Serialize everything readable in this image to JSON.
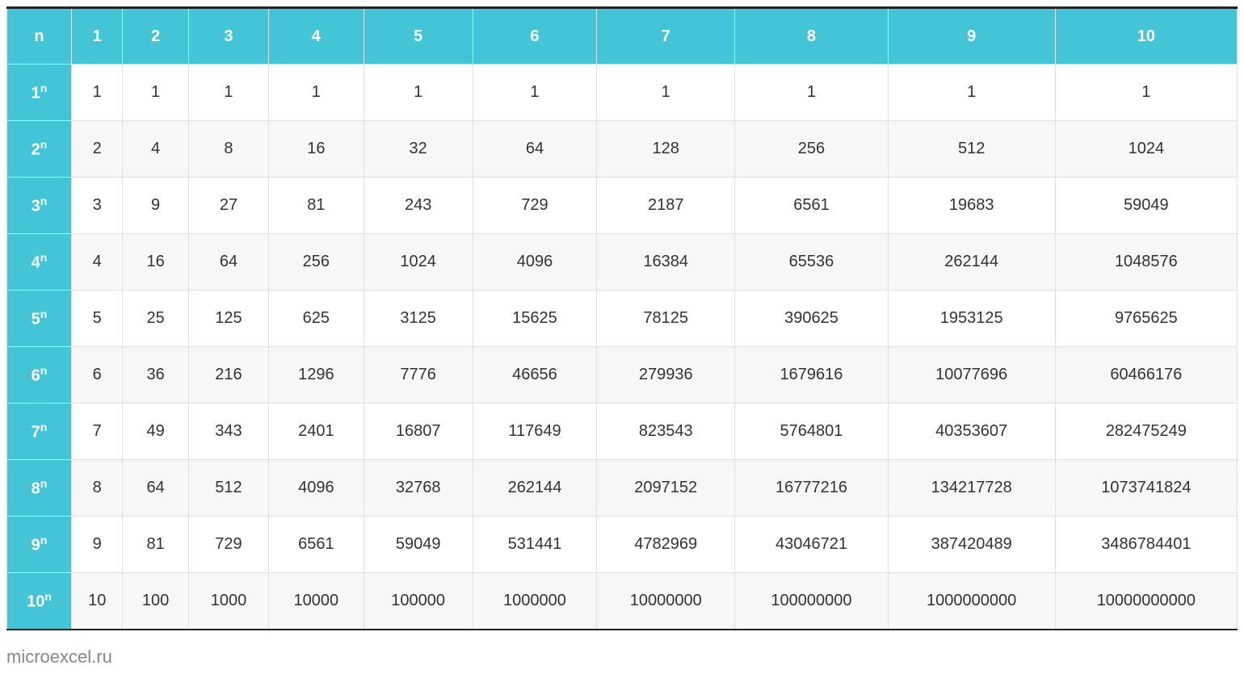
{
  "chart_data": {
    "type": "table",
    "corner_label": "n",
    "column_headers": [
      "1",
      "2",
      "3",
      "4",
      "5",
      "6",
      "7",
      "8",
      "9",
      "10"
    ],
    "rows": [
      {
        "base": 1,
        "values": [
          1,
          1,
          1,
          1,
          1,
          1,
          1,
          1,
          1,
          1
        ]
      },
      {
        "base": 2,
        "values": [
          2,
          4,
          8,
          16,
          32,
          64,
          128,
          256,
          512,
          1024
        ]
      },
      {
        "base": 3,
        "values": [
          3,
          9,
          27,
          81,
          243,
          729,
          2187,
          6561,
          19683,
          59049
        ]
      },
      {
        "base": 4,
        "values": [
          4,
          16,
          64,
          256,
          1024,
          4096,
          16384,
          65536,
          262144,
          1048576
        ]
      },
      {
        "base": 5,
        "values": [
          5,
          25,
          125,
          625,
          3125,
          15625,
          78125,
          390625,
          1953125,
          9765625
        ]
      },
      {
        "base": 6,
        "values": [
          6,
          36,
          216,
          1296,
          7776,
          46656,
          279936,
          1679616,
          10077696,
          60466176
        ]
      },
      {
        "base": 7,
        "values": [
          7,
          49,
          343,
          2401,
          16807,
          117649,
          823543,
          5764801,
          40353607,
          282475249
        ]
      },
      {
        "base": 8,
        "values": [
          8,
          64,
          512,
          4096,
          32768,
          262144,
          2097152,
          16777216,
          134217728,
          1073741824
        ]
      },
      {
        "base": 9,
        "values": [
          9,
          81,
          729,
          6561,
          59049,
          531441,
          4782969,
          43046721,
          387420489,
          3486784401
        ]
      },
      {
        "base": 10,
        "values": [
          10,
          100,
          1000,
          10000,
          100000,
          1000000,
          10000000,
          100000000,
          1000000000,
          10000000000
        ]
      }
    ],
    "exponent_symbol": "n"
  },
  "footer": "microexcel.ru"
}
